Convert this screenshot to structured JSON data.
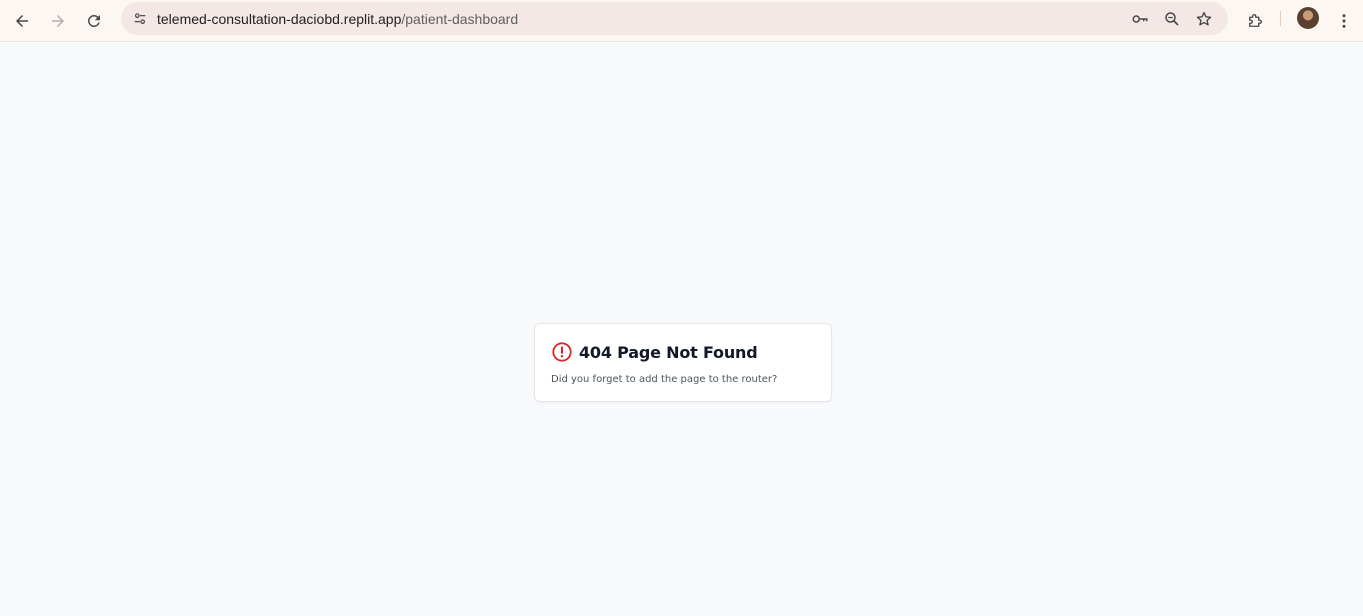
{
  "browser": {
    "url_host": "telemed-consultation-daciobd.replit.app",
    "url_path": "/patient-dashboard",
    "icons": {
      "back": "arrow-left-icon",
      "forward": "arrow-right-icon",
      "reload": "reload-icon",
      "site_info": "tune-icon",
      "password": "key-icon",
      "zoom": "zoom-icon",
      "bookmark": "star-icon",
      "extensions": "puzzle-icon",
      "menu": "kebab-menu-icon"
    }
  },
  "error_card": {
    "title": "404 Page Not Found",
    "description": "Did you forget to add the page to the router?",
    "icon": "alert-circle-icon",
    "icon_color": "#dc2626"
  },
  "colors": {
    "page_background": "#f8f9fb",
    "toolbar_background": "#fdf7f4",
    "omnibox_background": "#f3e8e5"
  }
}
